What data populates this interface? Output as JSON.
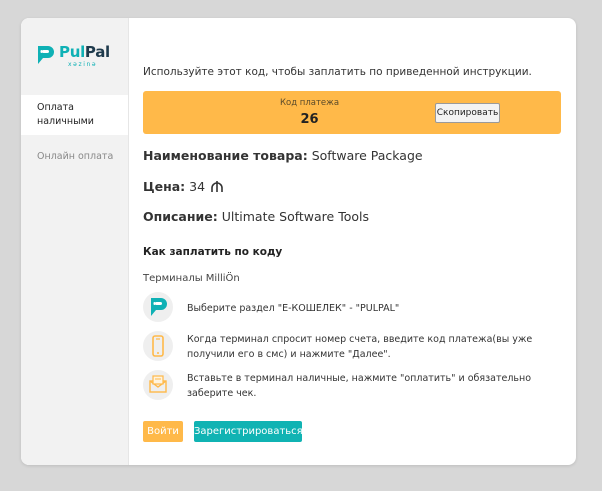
{
  "brand": {
    "name_part1": "Pul",
    "name_part2": "Pal",
    "subtitle": "xəzinə",
    "accent_teal": "#0fb1b5",
    "accent_orange": "#ffb949"
  },
  "sidebar": {
    "items": [
      {
        "label": "Оплата наличными",
        "active": true
      },
      {
        "label": "Онлайн оплата",
        "active": false
      }
    ]
  },
  "main": {
    "intro": "Используйте этот код, чтобы заплатить по приведенной инструкции.",
    "payment_code": {
      "label": "Код платежа",
      "value": "26",
      "copy_label": "Скопировать"
    },
    "product": {
      "name_label": "Наименование товара:",
      "name_value": "Software Package",
      "price_label": "Цена:",
      "price_value": "34",
      "currency_icon": "manat-icon",
      "description_label": "Описание:",
      "description_value": "Ultimate Software Tools"
    },
    "howto_title": "Как заплатить по коду",
    "terminals_title": "Терминалы MilliÖn",
    "steps": [
      {
        "icon": "pulpal-logo-icon",
        "text": "Выберите раздел \"E-КОШЕЛЕК\" - \"PULPAL\""
      },
      {
        "icon": "phone-icon",
        "text": "Когда терминал спросит номер счета, введите код платежа(вы уже получили его в смс) и нажмите \"Далее\"."
      },
      {
        "icon": "envelope-icon",
        "text": "Вставьте в терминал наличные, нажмите \"оплатить\" и обязательно заберите чек."
      }
    ],
    "buttons": {
      "login": "Войти",
      "register": "Зарегистрироваться"
    }
  }
}
